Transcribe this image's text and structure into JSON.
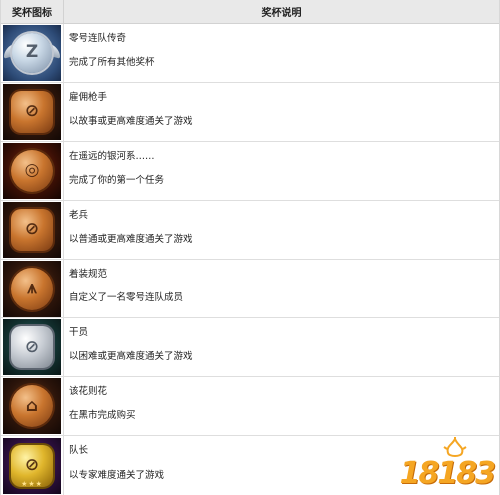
{
  "header": {
    "icon_col": "奖杯图标",
    "desc_col": "奖杯说明"
  },
  "trophies": [
    {
      "name": "零号连队传奇",
      "description": "完成了所有其他奖杯",
      "tier": "platinum",
      "icon": "winged-emblem-icon",
      "background": "#2e4c78"
    },
    {
      "name": "雇佣枪手",
      "description": "以故事或更高难度通关了游戏",
      "tier": "bronze",
      "icon": "z-emblem-icon",
      "background": "#2b140a"
    },
    {
      "name": "在遥远的银河系……",
      "description": "完成了你的第一个任务",
      "tier": "bronze",
      "icon": "signal-emblem-icon",
      "background": "#3a0f05"
    },
    {
      "name": "老兵",
      "description": "以普通或更高难度通关了游戏",
      "tier": "bronze",
      "icon": "z-emblem-icon",
      "background": "#2b140a"
    },
    {
      "name": "着装规范",
      "description": "自定义了一名零号连队成员",
      "tier": "bronze",
      "icon": "armor-emblem-icon",
      "background": "#2b140a"
    },
    {
      "name": "干员",
      "description": "以困难或更高难度通关了游戏",
      "tier": "silver",
      "icon": "z-emblem-icon",
      "background": "#12302f"
    },
    {
      "name": "该花则花",
      "description": "在黑市完成购买",
      "tier": "bronze",
      "icon": "bag-emblem-icon",
      "background": "#2b140a"
    },
    {
      "name": "队长",
      "description": "以专家难度通关了游戏",
      "tier": "gold",
      "icon": "z-emblem-icon",
      "background": "#2c0f3d"
    }
  ],
  "watermark": {
    "text": "18183",
    "color": "#f5a623"
  }
}
